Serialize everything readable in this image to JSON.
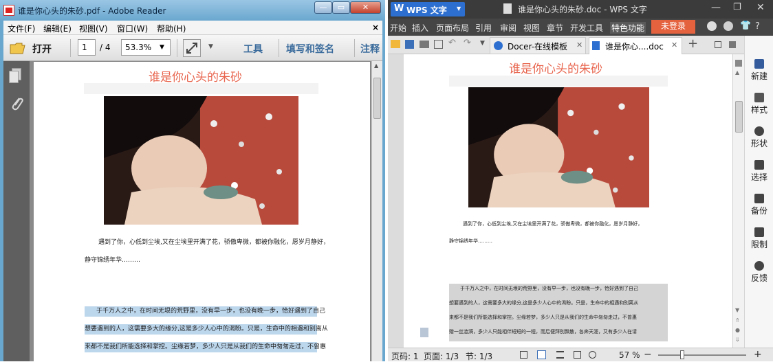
{
  "adobe": {
    "window_title": "谁是你心头的朱砂.pdf - Adobe Reader",
    "window_buttons": [
      "—",
      "▭",
      "✕"
    ],
    "menu": [
      "文件(F)",
      "编辑(E)",
      "视图(V)",
      "窗口(W)",
      "帮助(H)"
    ],
    "menu_close": "×",
    "toolbar": {
      "open_label": "打开",
      "page_current": "1",
      "page_total": "/ 4",
      "zoom": "53.3%",
      "tools_label": "工具",
      "sign_label": "填写和签名",
      "comment_label": "注释"
    },
    "document": {
      "title": "谁是你心头的朱砂",
      "para1_line1": "遇到了你，心低到尘埃,又在尘埃里开满了花，骄傲卑微，都被你融化，愿岁月静好，",
      "para1_line2": "静守锦绣年华………",
      "para2_line1": "于千万人之中，在时间无垠的荒野里，没有早一步，也没有晚一步，恰好遇到了自己",
      "para2_line2": "想要遇到的人，这需要多大的缘分,这是多少人心中的渴盼。只是，生命中的相遇和别离从",
      "para2_line3": "来都不是我们所能选择和掌控。尘缘若梦，多少人只是从我们的生命中匆匆走过，不曾惠"
    }
  },
  "wps": {
    "app_label": "WPS 文字",
    "window_title": "谁是你心头的朱砂.doc - WPS 文字",
    "menu": [
      "开始",
      "插入",
      "页面布局",
      "引用",
      "审阅",
      "视图",
      "章节",
      "开发工具",
      "特色功能"
    ],
    "login_label": "未登录",
    "tabs": [
      "Docer-在线模板",
      "谁是你心....doc"
    ],
    "add_tab": "+",
    "sidebar": [
      "新建",
      "样式",
      "形状",
      "选择",
      "备份",
      "限制",
      "反馈"
    ],
    "document": {
      "title": "谁是你心头的朱砂",
      "para1_line1": "遇到了你，心低到尘埃,又在尘埃里开满了花，骄傲卑微，都被你融化，愿岁月静好，",
      "para1_line2": "静守锦绣年华………",
      "para2_line1": "于千万人之中，在时间无垠的荒野里，没有早一步，也没有晚一步，恰好遇到了自己",
      "para2_line2": "想要遇到的人，这需要多大的缘分,这是多少人心中的渴盼。只是，生命中的相遇和别离从",
      "para2_line3": "来都不是我们所能选择和掌控。尘缘若梦，多少人只是从我们的生命中匆匆走过，不曾惠",
      "para2_line4": "赠一丝涟漪，多少人只能相伴短短的一程，而后便拜别飘散，各奔天涯，又有多少人在请"
    },
    "status": {
      "page_no": "页码: 1",
      "page": "页面: 1/3",
      "section": "节: 1/3",
      "zoom": "57 %",
      "zoom_out": "−",
      "zoom_in": "+"
    }
  },
  "colors": {
    "title_red": "#e8654e",
    "wps_blue": "#2d6fd0",
    "login_orange": "#e5623f",
    "highlight": "#bcd6ec"
  }
}
